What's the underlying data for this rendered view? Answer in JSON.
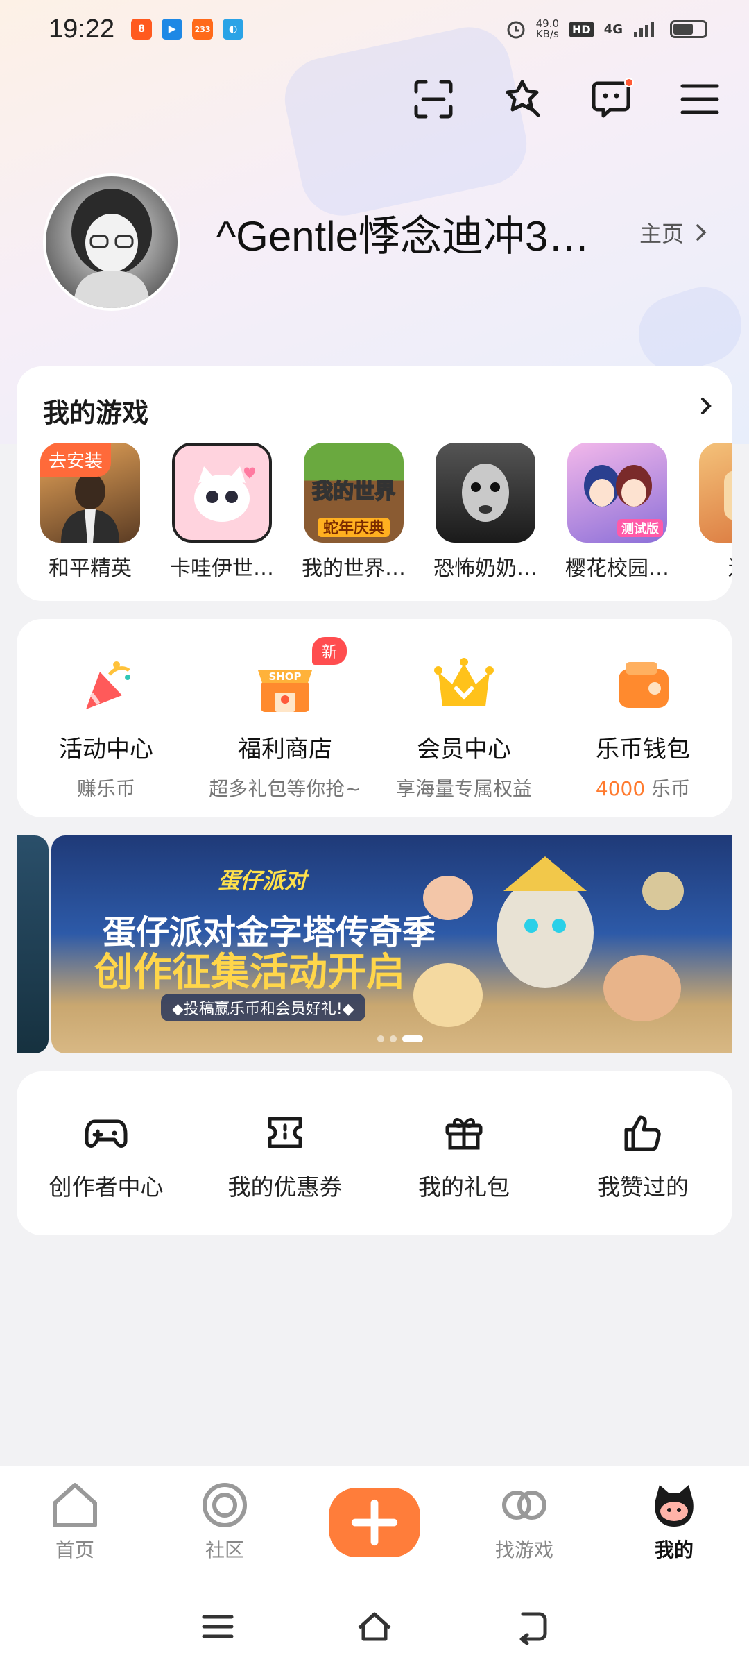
{
  "status_bar": {
    "time": "19:22",
    "net_speed_value": "49.0",
    "net_speed_unit": "KB/s",
    "hd": "HD",
    "network": "4G",
    "app_icons": [
      {
        "name": "taobao-icon",
        "text": "8",
        "color": "#ff5a1f"
      },
      {
        "name": "video-app-icon",
        "text": "▶",
        "color": "#1e88e5"
      },
      {
        "name": "233-app-icon",
        "text": "233",
        "color": "#ff6a1a"
      },
      {
        "name": "browser-icon",
        "text": "◐",
        "color": "#2aa3e6"
      }
    ]
  },
  "profile": {
    "username": "^Gentle悸念迪冲3…",
    "homepage_label": "主页"
  },
  "my_games": {
    "title": "我的游戏",
    "install_tag": "去安装",
    "games": [
      {
        "label": "和平精英",
        "color1": "#d98a3a",
        "color2": "#5a3b23"
      },
      {
        "label": "卡哇伊世…",
        "color1": "#ffd3de",
        "color2": "#f7aac0"
      },
      {
        "label": "我的世界…",
        "color1": "#6aa93f",
        "color2": "#8a5b32"
      },
      {
        "label": "恐怖奶奶…",
        "color1": "#777777",
        "color2": "#222222"
      },
      {
        "label": "樱花校园…",
        "color1": "#f3b8ea",
        "color2": "#8b6fd8"
      },
      {
        "label": "迷你",
        "color1": "#f4c27a",
        "color2": "#d9733a"
      }
    ]
  },
  "features": [
    {
      "title": "活动中心",
      "sub": "赚乐币"
    },
    {
      "title": "福利商店",
      "sub": "超多礼包等你抢~",
      "tag": "新"
    },
    {
      "title": "会员中心",
      "sub": "享海量专属权益"
    },
    {
      "title": "乐币钱包",
      "coins": "4000",
      "coins_unit": " 乐币"
    }
  ],
  "banner": {
    "brand": "蛋仔派对",
    "title1": "蛋仔派对金字塔传奇季",
    "title2": "创作征集活动开启",
    "subtitle": "◆投稿赢乐币和会员好礼!◆"
  },
  "tools": [
    {
      "label": "创作者中心"
    },
    {
      "label": "我的优惠券"
    },
    {
      "label": "我的礼包"
    },
    {
      "label": "我赞过的"
    }
  ],
  "bottom_nav": {
    "home": "首页",
    "community": "社区",
    "find_games": "找游戏",
    "mine": "我的"
  },
  "colors": {
    "accent": "#ff7d3a",
    "badge_red": "#ff4d4f"
  }
}
